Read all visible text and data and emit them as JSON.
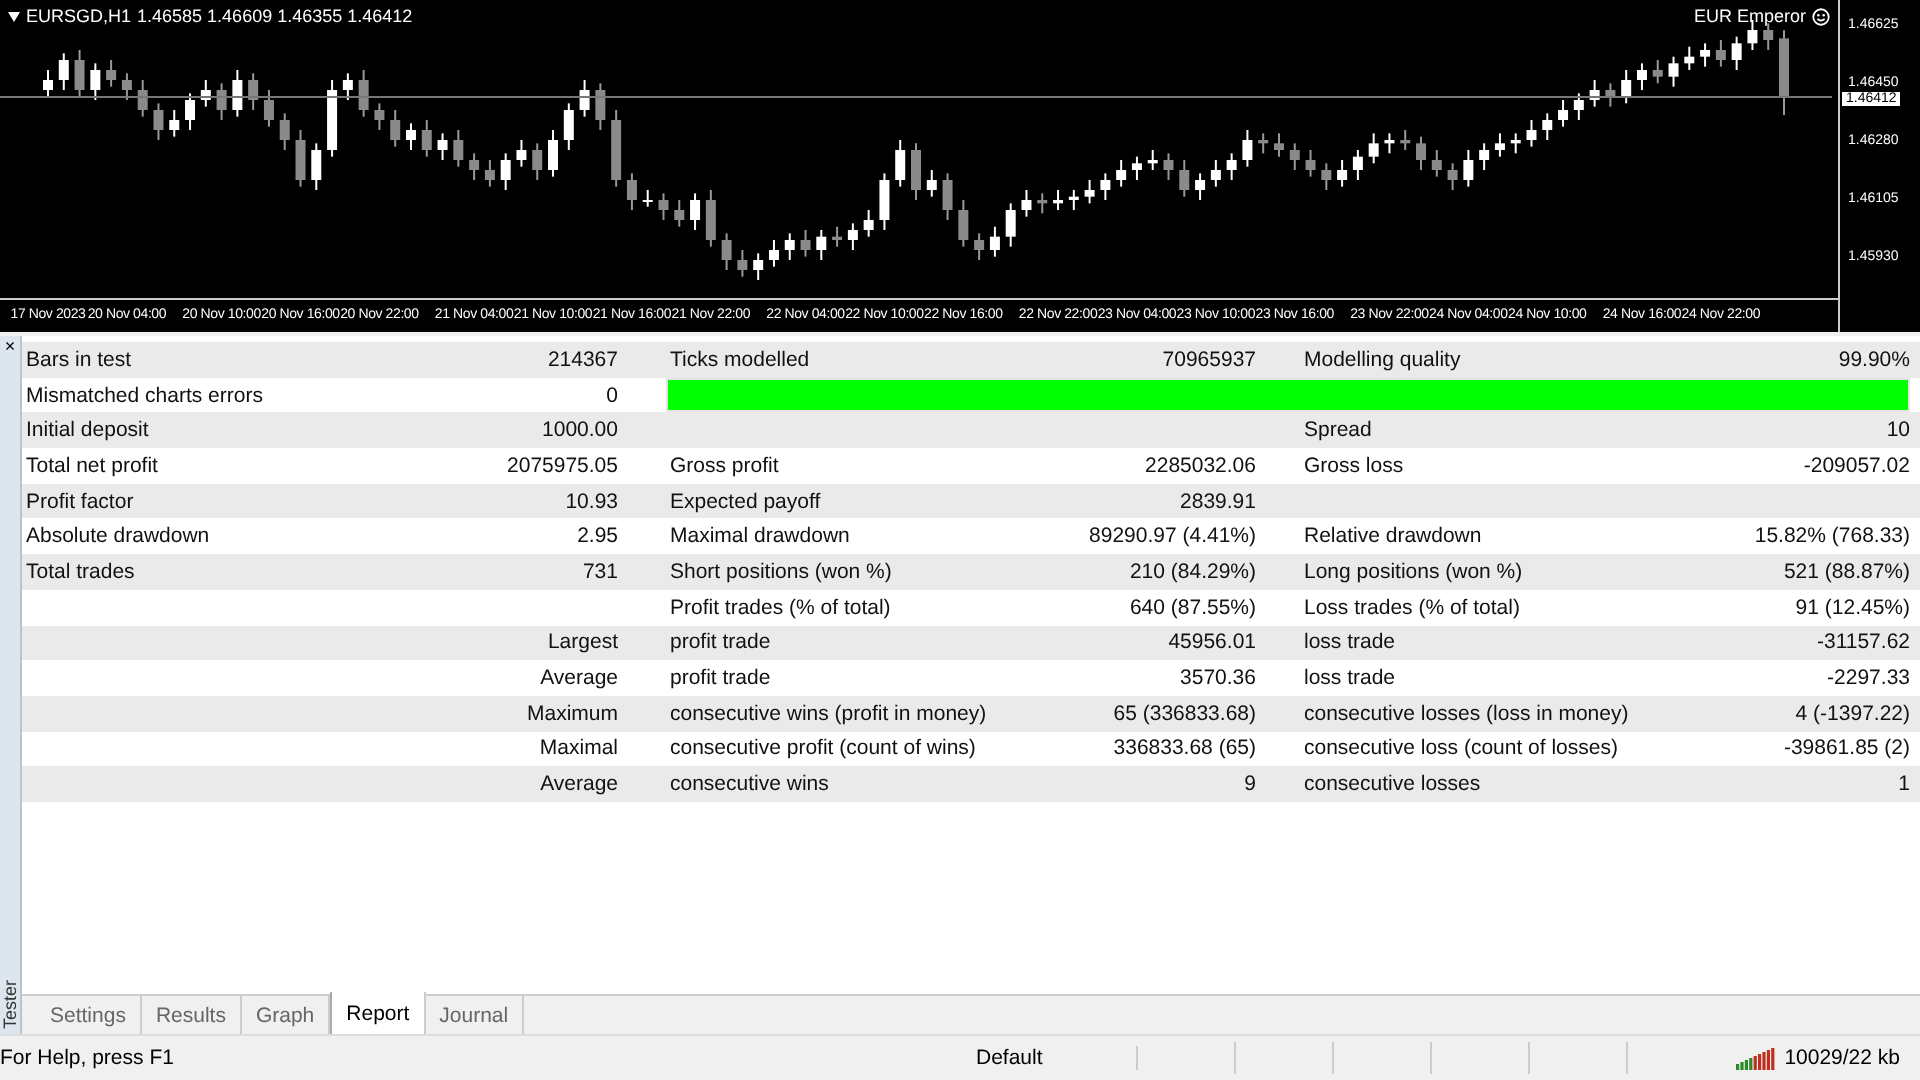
{
  "chart": {
    "symbol": "EURSGD,H1",
    "ohlc": "1.46585 1.46609 1.46355 1.46412",
    "expert": "EUR Emperor",
    "current_price": "1.46412",
    "chart_data": {
      "type": "candlestick",
      "ylim": [
        1.45824,
        1.467
      ],
      "ref_lines": [
        {
          "axis": "y",
          "value": 1.46412
        }
      ],
      "yticks": [
        {
          "value": 1.46625,
          "label": "1.46625"
        },
        {
          "value": 1.4645,
          "label": "1.46450"
        },
        {
          "value": 1.4628,
          "label": "1.46280"
        },
        {
          "value": 1.46105,
          "label": "1.46105"
        },
        {
          "value": 1.4593,
          "label": "1.45930"
        }
      ],
      "categories": [
        "17 Nov 2023",
        null,
        null,
        null,
        null,
        "20 Nov 04:00",
        null,
        null,
        null,
        null,
        null,
        "20 Nov 10:00",
        null,
        null,
        null,
        null,
        "20 Nov 16:00",
        null,
        null,
        null,
        null,
        "20 Nov 22:00",
        null,
        null,
        null,
        null,
        null,
        "21 Nov 04:00",
        null,
        null,
        null,
        null,
        "21 Nov 10:00",
        null,
        null,
        null,
        null,
        "21 Nov 16:00",
        null,
        null,
        null,
        null,
        "21 Nov 22:00",
        null,
        null,
        null,
        null,
        null,
        "22 Nov 04:00",
        null,
        null,
        null,
        null,
        "22 Nov 10:00",
        null,
        null,
        null,
        null,
        "22 Nov 16:00",
        null,
        null,
        null,
        null,
        null,
        "22 Nov 22:00",
        null,
        null,
        null,
        null,
        "23 Nov 04:00",
        null,
        null,
        null,
        null,
        "23 Nov 10:00",
        null,
        null,
        null,
        null,
        "23 Nov 16:00",
        null,
        null,
        null,
        null,
        null,
        "23 Nov 22:00",
        null,
        null,
        null,
        null,
        "24 Nov 04:00",
        null,
        null,
        null,
        null,
        "24 Nov 10:00",
        null,
        null,
        null,
        null,
        null,
        "24 Nov 16:00",
        null,
        null,
        null,
        null,
        "24 Nov 22:00",
        null,
        null,
        null,
        null
      ],
      "ohlc": [
        [
          1.4643,
          1.4649,
          1.4641,
          1.4646
        ],
        [
          1.4646,
          1.4654,
          1.4643,
          1.4652
        ],
        [
          1.4652,
          1.4655,
          1.4641,
          1.4643
        ],
        [
          1.4643,
          1.4651,
          1.464,
          1.4649
        ],
        [
          1.4649,
          1.4652,
          1.4644,
          1.4646
        ],
        [
          1.4646,
          1.4648,
          1.464,
          1.4643
        ],
        [
          1.4643,
          1.4646,
          1.4635,
          1.4637
        ],
        [
          1.4637,
          1.4639,
          1.4628,
          1.4631
        ],
        [
          1.4631,
          1.4637,
          1.4629,
          1.4634
        ],
        [
          1.4634,
          1.4642,
          1.4631,
          1.464
        ],
        [
          1.464,
          1.4646,
          1.4638,
          1.4643
        ],
        [
          1.4643,
          1.4645,
          1.4634,
          1.4637
        ],
        [
          1.4637,
          1.4649,
          1.4635,
          1.4646
        ],
        [
          1.4646,
          1.4648,
          1.4637,
          1.464
        ],
        [
          1.464,
          1.4643,
          1.4632,
          1.4634
        ],
        [
          1.4634,
          1.4636,
          1.4625,
          1.4628
        ],
        [
          1.4628,
          1.4631,
          1.4614,
          1.4616
        ],
        [
          1.4616,
          1.4627,
          1.4613,
          1.4625
        ],
        [
          1.4625,
          1.4646,
          1.4623,
          1.4643
        ],
        [
          1.4643,
          1.4648,
          1.464,
          1.4646
        ],
        [
          1.4646,
          1.4649,
          1.4635,
          1.4637
        ],
        [
          1.4637,
          1.4639,
          1.4631,
          1.4634
        ],
        [
          1.4634,
          1.4637,
          1.4626,
          1.4628
        ],
        [
          1.4628,
          1.4633,
          1.4625,
          1.4631
        ],
        [
          1.4631,
          1.4634,
          1.4623,
          1.4625
        ],
        [
          1.4625,
          1.463,
          1.4622,
          1.4628
        ],
        [
          1.4628,
          1.4631,
          1.462,
          1.4622
        ],
        [
          1.4622,
          1.4624,
          1.4616,
          1.4619
        ],
        [
          1.4619,
          1.4622,
          1.4614,
          1.4616
        ],
        [
          1.4616,
          1.4624,
          1.4613,
          1.4622
        ],
        [
          1.4622,
          1.4628,
          1.462,
          1.4625
        ],
        [
          1.4625,
          1.4627,
          1.4616,
          1.4619
        ],
        [
          1.4619,
          1.4631,
          1.4617,
          1.4628
        ],
        [
          1.4628,
          1.4639,
          1.4625,
          1.4637
        ],
        [
          1.4637,
          1.4646,
          1.4635,
          1.4643
        ],
        [
          1.4643,
          1.4645,
          1.4631,
          1.4634
        ],
        [
          1.4634,
          1.4637,
          1.4614,
          1.4616
        ],
        [
          1.4616,
          1.4618,
          1.4607,
          1.461
        ],
        [
          1.461,
          1.4613,
          1.4608,
          1.461
        ],
        [
          1.461,
          1.4612,
          1.4604,
          1.4607
        ],
        [
          1.4607,
          1.461,
          1.4602,
          1.4604
        ],
        [
          1.4604,
          1.4612,
          1.4601,
          1.461
        ],
        [
          1.461,
          1.4613,
          1.4596,
          1.4598
        ],
        [
          1.4598,
          1.46,
          1.4589,
          1.4592
        ],
        [
          1.4592,
          1.4595,
          1.4587,
          1.4589
        ],
        [
          1.4589,
          1.4594,
          1.4586,
          1.4592
        ],
        [
          1.4592,
          1.4598,
          1.459,
          1.4595
        ],
        [
          1.4595,
          1.46,
          1.4592,
          1.4598
        ],
        [
          1.4598,
          1.4601,
          1.4593,
          1.4595
        ],
        [
          1.4595,
          1.4601,
          1.4592,
          1.4599
        ],
        [
          1.4599,
          1.4602,
          1.4596,
          1.4598
        ],
        [
          1.4598,
          1.4603,
          1.4595,
          1.4601
        ],
        [
          1.4601,
          1.4607,
          1.4599,
          1.4604
        ],
        [
          1.4604,
          1.4618,
          1.4601,
          1.4616
        ],
        [
          1.4616,
          1.4628,
          1.4614,
          1.4625
        ],
        [
          1.4625,
          1.4627,
          1.461,
          1.4613
        ],
        [
          1.4613,
          1.4619,
          1.4611,
          1.4616
        ],
        [
          1.4616,
          1.4618,
          1.4604,
          1.4607
        ],
        [
          1.4607,
          1.461,
          1.4596,
          1.4598
        ],
        [
          1.4598,
          1.46,
          1.4592,
          1.4595
        ],
        [
          1.4595,
          1.4602,
          1.4593,
          1.4599
        ],
        [
          1.4599,
          1.4609,
          1.4596,
          1.4607
        ],
        [
          1.4607,
          1.4613,
          1.4605,
          1.461
        ],
        [
          1.461,
          1.4612,
          1.4606,
          1.4609
        ],
        [
          1.4609,
          1.4613,
          1.4607,
          1.461
        ],
        [
          1.461,
          1.4613,
          1.4607,
          1.4611
        ],
        [
          1.4611,
          1.4616,
          1.4609,
          1.4613
        ],
        [
          1.4613,
          1.4618,
          1.461,
          1.4616
        ],
        [
          1.4616,
          1.4622,
          1.4614,
          1.4619
        ],
        [
          1.4619,
          1.4623,
          1.4616,
          1.4621
        ],
        [
          1.4621,
          1.4625,
          1.4619,
          1.4622
        ],
        [
          1.4622,
          1.4624,
          1.4616,
          1.4619
        ],
        [
          1.4619,
          1.4622,
          1.4611,
          1.4613
        ],
        [
          1.4613,
          1.4618,
          1.461,
          1.4616
        ],
        [
          1.4616,
          1.4622,
          1.4614,
          1.4619
        ],
        [
          1.4619,
          1.4624,
          1.4616,
          1.4622
        ],
        [
          1.4622,
          1.4631,
          1.462,
          1.4628
        ],
        [
          1.4628,
          1.463,
          1.4624,
          1.4627
        ],
        [
          1.4627,
          1.463,
          1.4623,
          1.4625
        ],
        [
          1.4625,
          1.4627,
          1.4619,
          1.4622
        ],
        [
          1.4622,
          1.4625,
          1.4617,
          1.4619
        ],
        [
          1.4619,
          1.4621,
          1.4613,
          1.4616
        ],
        [
          1.4616,
          1.4622,
          1.4614,
          1.4619
        ],
        [
          1.4619,
          1.4625,
          1.4616,
          1.4623
        ],
        [
          1.4623,
          1.463,
          1.4621,
          1.4627
        ],
        [
          1.4627,
          1.463,
          1.4624,
          1.4628
        ],
        [
          1.4628,
          1.4631,
          1.4625,
          1.4627
        ],
        [
          1.4627,
          1.4629,
          1.4619,
          1.4622
        ],
        [
          1.4622,
          1.4625,
          1.4617,
          1.4619
        ],
        [
          1.4619,
          1.4621,
          1.4613,
          1.4616
        ],
        [
          1.4616,
          1.4625,
          1.4614,
          1.4622
        ],
        [
          1.4622,
          1.4627,
          1.4619,
          1.4625
        ],
        [
          1.4625,
          1.463,
          1.4623,
          1.4627
        ],
        [
          1.4627,
          1.463,
          1.4624,
          1.4628
        ],
        [
          1.4628,
          1.4634,
          1.4626,
          1.4631
        ],
        [
          1.4631,
          1.4636,
          1.4628,
          1.4634
        ],
        [
          1.4634,
          1.464,
          1.4632,
          1.4637
        ],
        [
          1.4637,
          1.4642,
          1.4634,
          1.464
        ],
        [
          1.464,
          1.4646,
          1.4638,
          1.4643
        ],
        [
          1.4643,
          1.4645,
          1.4638,
          1.4641
        ],
        [
          1.4641,
          1.4649,
          1.4639,
          1.4646
        ],
        [
          1.4646,
          1.4651,
          1.4643,
          1.4649
        ],
        [
          1.4649,
          1.4652,
          1.4645,
          1.4647
        ],
        [
          1.4647,
          1.4653,
          1.4644,
          1.4651
        ],
        [
          1.4651,
          1.4656,
          1.4649,
          1.4653
        ],
        [
          1.4653,
          1.4657,
          1.465,
          1.4655
        ],
        [
          1.4655,
          1.4658,
          1.465,
          1.4652
        ],
        [
          1.4652,
          1.4659,
          1.4649,
          1.4657
        ],
        [
          1.4657,
          1.4664,
          1.4655,
          1.4661
        ],
        [
          1.4661,
          1.4663,
          1.4655,
          1.4658
        ],
        [
          1.46585,
          1.46609,
          1.46355,
          1.46412
        ]
      ]
    }
  },
  "tester": {
    "close": "×",
    "title": "Tester",
    "rows": [
      {
        "kind": "text",
        "label_1": "Bars in test",
        "value_1": "214367",
        "label_2": "Ticks modelled",
        "value_2": "70965937",
        "label_3": "Modelling quality",
        "value_3": "99.90%"
      },
      {
        "kind": "quality_bar",
        "label_1": "Mismatched charts errors",
        "value_1": "0",
        "level": 1
      },
      {
        "kind": "text",
        "label_1": "Initial deposit",
        "value_1": "1000.00",
        "label_3": "Spread",
        "value_3": "10"
      },
      {
        "kind": "text",
        "label_1": "Total net profit",
        "value_1": "2075975.05",
        "label_2": "Gross profit",
        "value_2": "2285032.06",
        "label_3": "Gross loss",
        "value_3": "-209057.02"
      },
      {
        "kind": "text",
        "label_1": "Profit factor",
        "value_1": "10.93",
        "label_2": "Expected payoff",
        "value_2": "2839.91"
      },
      {
        "kind": "text",
        "label_1": "Absolute drawdown",
        "value_1": "2.95",
        "label_2": "Maximal drawdown",
        "value_2": "89290.97 (4.41%)",
        "label_3": "Relative drawdown",
        "value_3": "15.82% (768.33)"
      },
      {
        "kind": "text",
        "label_1": "Total trades",
        "value_1": "731",
        "label_2": "Short positions (won %)",
        "value_2": "210 (84.29%)",
        "label_3": "Long positions (won %)",
        "value_3": "521 (88.87%)"
      },
      {
        "kind": "text",
        "label_2": "Profit trades (% of total)",
        "value_2": "640 (87.55%)",
        "label_3": "Loss trades (% of total)",
        "value_3": "91 (12.45%)"
      },
      {
        "kind": "text",
        "value_1": "Largest",
        "label_2": "profit trade",
        "value_2": "45956.01",
        "label_3": "loss trade",
        "value_3": "-31157.62"
      },
      {
        "kind": "text",
        "value_1": "Average",
        "label_2": "profit trade",
        "value_2": "3570.36",
        "label_3": "loss trade",
        "value_3": "-2297.33"
      },
      {
        "kind": "text",
        "value_1": "Maximum",
        "label_2": "consecutive wins (profit in money)",
        "value_2": "65 (336833.68)",
        "label_3": "consecutive losses (loss in money)",
        "value_3": "4 (-1397.22)"
      },
      {
        "kind": "text",
        "value_1": "Maximal",
        "label_2": "consecutive profit (count of wins)",
        "value_2": "336833.68 (65)",
        "label_3": "consecutive loss (count of losses)",
        "value_3": "-39861.85 (2)"
      },
      {
        "kind": "text",
        "value_1": "Average",
        "label_2": "consecutive wins",
        "value_2": "9",
        "label_3": "consecutive losses",
        "value_3": "1"
      }
    ],
    "tabs": [
      {
        "label": "Settings",
        "selected": false
      },
      {
        "label": "Results",
        "selected": false
      },
      {
        "label": "Graph",
        "selected": false
      },
      {
        "label": "Report",
        "selected": true
      },
      {
        "label": "Journal",
        "selected": false
      }
    ]
  },
  "status_bar": {
    "help": "For Help, press F1",
    "profile": "Default",
    "traffic": "10029/22 kb"
  }
}
